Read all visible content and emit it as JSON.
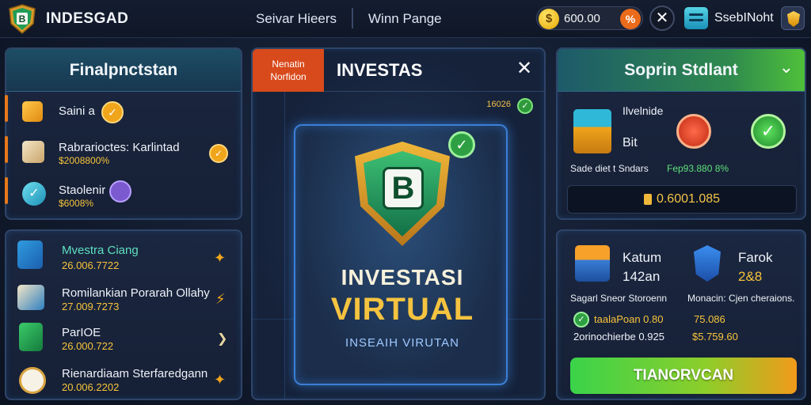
{
  "header": {
    "brand": "INDESGAD",
    "logo_letter": "B",
    "nav_1": "Seivar Hieers",
    "nav_2": "Winn Pange",
    "coin_value": "600.00",
    "coin_symbol": "$",
    "coin_action_symbol": "%",
    "close_symbol": "✕",
    "profile_name": "SsebINoht"
  },
  "left_panel_top": {
    "title": "Finalpnctstan",
    "rows": [
      {
        "label": "Saini a",
        "sub": ""
      },
      {
        "label": "Rabrarioctes: Karlintad",
        "sub": "$2008800%"
      },
      {
        "label": "Staolenir",
        "sub": "$6008%"
      }
    ]
  },
  "left_panel_bottom": {
    "rows": [
      {
        "label": "Mvestra Ciang",
        "value": "26.006.7722"
      },
      {
        "label": "Romilankian Porarah Ollahy",
        "value": "27.009.7273"
      },
      {
        "label": "ParIOE",
        "value": "26.000.722"
      },
      {
        "label": "Rienardiaam Sterfaredgann",
        "value": "20.006.2202"
      }
    ]
  },
  "center_panel": {
    "tag": "Nenatin Norfidon",
    "title": "INVESTAS",
    "close": "✕",
    "small_value": "16026",
    "shield_letter": "B",
    "headline_1": "INVESTASI",
    "headline_2": "VIRTUAL",
    "subheadline": "INSEAIH VIRUTAN"
  },
  "right_panel_top": {
    "title": "Soprin Stdlant",
    "chevron": "⌄",
    "item_label_1": "Ilvelnide",
    "item_label_2": "Bit",
    "caption_left": "Sade diet t Sndars",
    "caption_right": "Fep93.880 8%",
    "value": "0.6001.085"
  },
  "right_panel_bottom": {
    "col1_title": "Katum",
    "col1_sub": "142an",
    "col1_caption": "Sagarl Sneor Storoenn",
    "col1_check_label": "taalaPoan 0.80",
    "col1_line2": "2orinochierbe 0.925",
    "col2_title": "Farok",
    "col2_sub": "2&8",
    "col2_caption": "Monacin: Cjen cheraions.",
    "col2_line1": "75.086",
    "col2_line2": "$5.759.60",
    "button_label": "TIANORVCAN"
  },
  "colors": {
    "accent_orange": "#e7791a",
    "gold": "#f5c33f",
    "green": "#3ad34a",
    "panel_border": "#2e4468"
  }
}
